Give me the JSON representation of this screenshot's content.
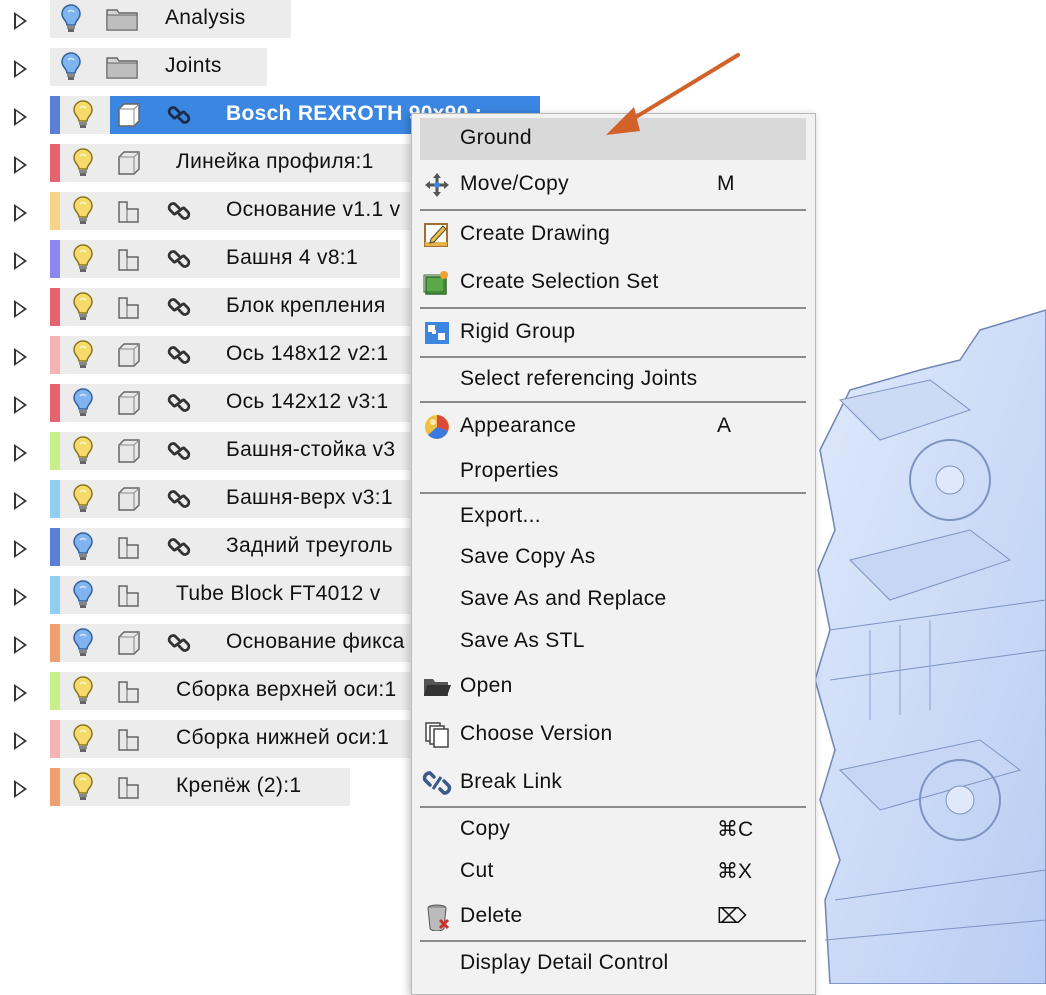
{
  "tree": {
    "rows": [
      {
        "label": "Analysis",
        "kind": "folder",
        "bulb": "blue",
        "bar": null,
        "link": false
      },
      {
        "label": "Joints",
        "kind": "folder",
        "bulb": "blue",
        "bar": null,
        "link": false
      },
      {
        "label": "Bosch REXROTH 90x90 :",
        "kind": "component",
        "bulb": "yellow",
        "bar": "#5b7fd6",
        "link": true,
        "selected": true
      },
      {
        "label": "Линейка профиля:1",
        "kind": "component",
        "bulb": "yellow",
        "bar": "#e5636f",
        "link": false
      },
      {
        "label": "Основание v1.1 v",
        "kind": "assembly",
        "bulb": "yellow",
        "bar": "#f7d48a",
        "link": true
      },
      {
        "label": "Башня 4 v8:1",
        "kind": "assembly",
        "bulb": "yellow",
        "bar": "#8c86f0",
        "link": true
      },
      {
        "label": "Блок крепления",
        "kind": "assembly",
        "bulb": "yellow",
        "bar": "#e5636f",
        "link": true
      },
      {
        "label": "Ось 148x12 v2:1",
        "kind": "component",
        "bulb": "yellow",
        "bar": "#f5b3b3",
        "link": true
      },
      {
        "label": "Ось 142x12 v3:1",
        "kind": "component",
        "bulb": "blue",
        "bar": "#e5636f",
        "link": true
      },
      {
        "label": "Башня-стойка v3",
        "kind": "component",
        "bulb": "yellow",
        "bar": "#c7ef8a",
        "link": true
      },
      {
        "label": "Башня-верх v3:1",
        "kind": "component",
        "bulb": "yellow",
        "bar": "#8fd0f2",
        "link": true
      },
      {
        "label": "Задний треуголь",
        "kind": "assembly",
        "bulb": "blue",
        "bar": "#5b7fd6",
        "link": true
      },
      {
        "label": "Tube Block FT4012 v",
        "kind": "assembly",
        "bulb": "blue",
        "bar": "#8fd0f2",
        "link": false
      },
      {
        "label": "Основание фикса",
        "kind": "component",
        "bulb": "blue",
        "bar": "#f0a070",
        "link": true
      },
      {
        "label": "Сборка верхней оси:1",
        "kind": "assembly",
        "bulb": "yellow",
        "bar": "#c7ef8a",
        "link": false
      },
      {
        "label": "Сборка нижней оси:1",
        "kind": "assembly",
        "bulb": "yellow",
        "bar": "#f5b3b3",
        "link": false
      },
      {
        "label": "Крепёж (2):1",
        "kind": "assembly",
        "bulb": "yellow",
        "bar": "#f0a070",
        "link": false
      }
    ]
  },
  "menu": {
    "ground": "Ground",
    "move_copy": "Move/Copy",
    "move_copy_short": "M",
    "create_drawing": "Create Drawing",
    "create_selection_set": "Create Selection Set",
    "rigid_group": "Rigid Group",
    "select_referencing_joints": "Select referencing Joints",
    "appearance": "Appearance",
    "appearance_short": "A",
    "properties": "Properties",
    "export": "Export...",
    "save_copy_as": "Save Copy As",
    "save_as_replace": "Save As and Replace",
    "save_as_stl": "Save As STL",
    "open": "Open",
    "choose_version": "Choose Version",
    "break_link": "Break Link",
    "copy": "Copy",
    "copy_short": "⌘C",
    "cut": "Cut",
    "cut_short": "⌘X",
    "delete": "Delete",
    "delete_short": "⌦",
    "display_detail_control": "Display Detail Control"
  },
  "colors": {
    "selection": "#3a86e0",
    "arrow": "#d2622a",
    "menu_bg": "#f2f2f2",
    "menu_highlight": "#d9d9d9"
  }
}
